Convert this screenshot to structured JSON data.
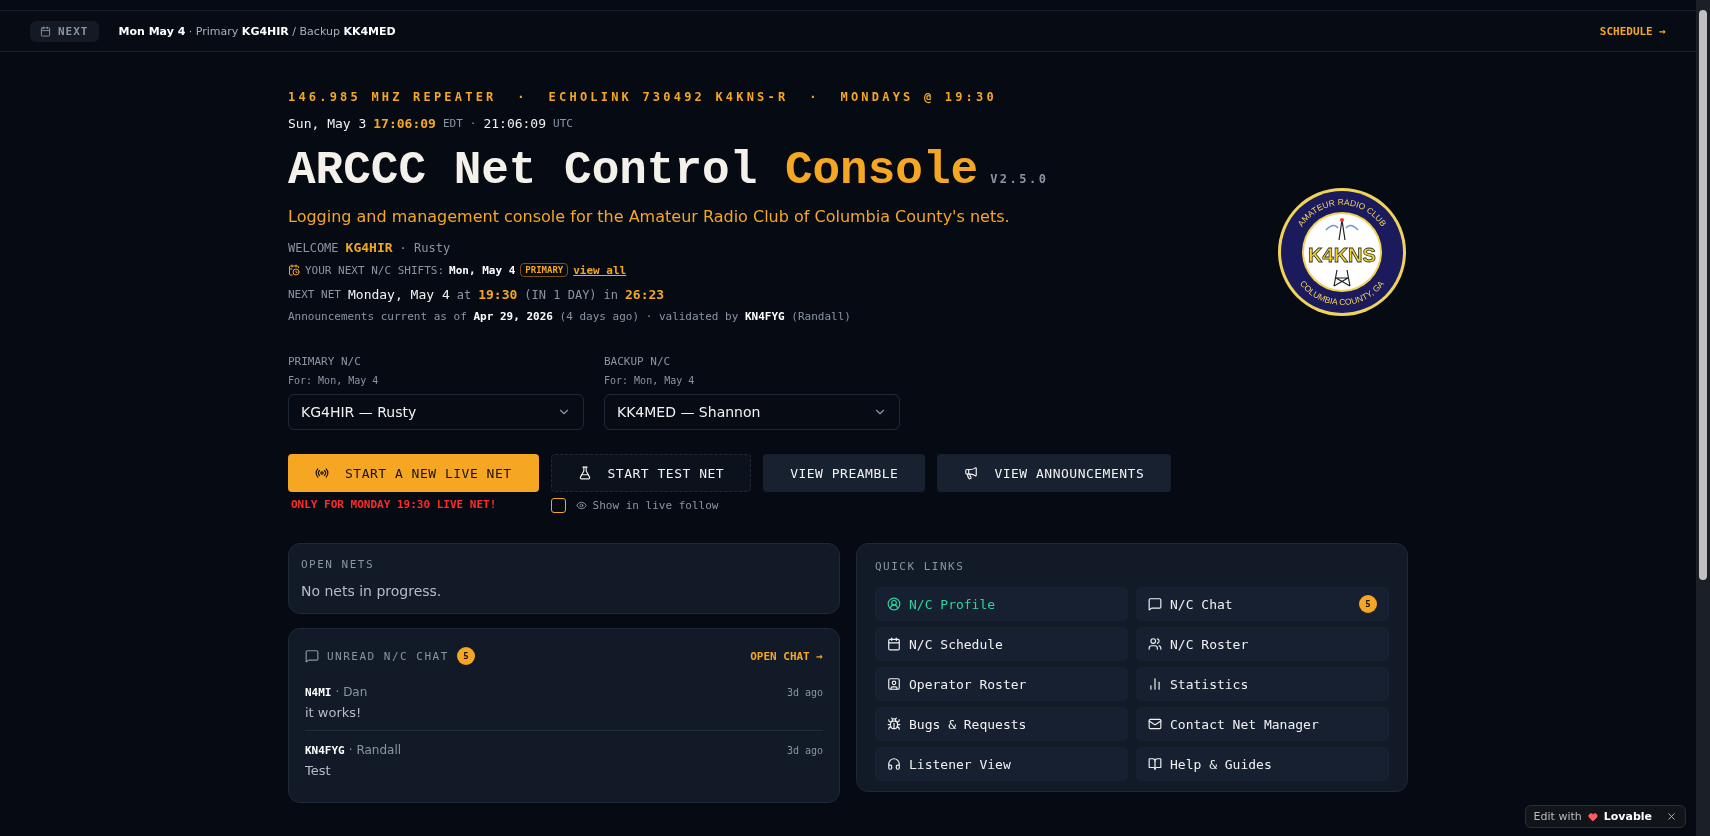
{
  "top_bar": {
    "label": "NEXT",
    "summary": "**Mon May 4** · Primary **KG4HIR** / Backup **KK4MED**",
    "schedule_link": "SCHEDULE →"
  },
  "header": {
    "tagline": "146.985 MHZ REPEATER  ·  ECHOLINK 730492 K4KNS-R  ·  MONDAYS @ 19:30",
    "clock": {
      "date": "Sun, May 3",
      "local_time": "17:06:09",
      "local_zone": "EDT",
      "separator": "·",
      "utc_time": "21:06:09",
      "utc_zone": "UTC"
    },
    "title": "ARCCC Net Control",
    "title_accent": "Console",
    "version": "V2.5.0",
    "subtitle": "Logging and management console for the Amateur Radio Club of Columbia County's nets.",
    "welcome": {
      "label": "WELCOME",
      "callsign": "KG4HIR",
      "name": "· Rusty"
    },
    "shifts": {
      "label": "YOUR NEXT N/C SHIFTS:",
      "date": "Mon, May 4",
      "badge": "PRIMARY",
      "link": "view all"
    },
    "next_net": {
      "label": "NEXT NET",
      "date": "Monday, May 4",
      "at": "at",
      "time": "19:30",
      "relative": "(IN 1 DAY)",
      "in": "in",
      "countdown": "26:23"
    },
    "announcements_note": "Announcements current as of **Apr 29, 2026** (4 days ago) · validated by **KN4FYG** (Randall)"
  },
  "logo": {
    "top_text": "AMATEUR RADIO CLUB",
    "callsign": "K4KNS",
    "bottom_text": "COLUMBIA COUNTY, GA"
  },
  "net_control": [
    {
      "label": "PRIMARY N/C",
      "for": "For: Mon, May 4",
      "value": "KG4HIR — Rusty"
    },
    {
      "label": "BACKUP N/C",
      "for": "For: Mon, May 4",
      "value": "KK4MED — Shannon"
    }
  ],
  "actions": [
    {
      "label": "START A NEW LIVE NET",
      "kind": "primary"
    },
    {
      "label": "START TEST NET",
      "kind": "dashed"
    },
    {
      "label": "VIEW PREAMBLE",
      "kind": "plain"
    },
    {
      "label": "VIEW ANNOUNCEMENTS",
      "kind": "plain"
    }
  ],
  "live_warning": "ONLY FOR MONDAY 19:30 LIVE NET!",
  "live_follow": {
    "label": "Show in live follow",
    "checked": false
  },
  "open_nets": {
    "title": "OPEN NETS",
    "empty_text": "No nets in progress."
  },
  "chat": {
    "title": "UNREAD N/C CHAT",
    "count": "5",
    "link": "OPEN CHAT →",
    "messages": [
      {
        "callsign": "N4MI",
        "name": "· Dan",
        "time": "3d ago",
        "text": "it works!"
      },
      {
        "callsign": "KN4FYG",
        "name": "· Randall",
        "time": "3d ago",
        "text": "Test"
      }
    ]
  },
  "quick_links": {
    "title": "QUICK LINKS",
    "items": [
      {
        "label": "N/C Profile",
        "selected": true
      },
      {
        "label": "N/C Chat",
        "selected": false,
        "badge": "5"
      },
      {
        "label": "N/C Schedule",
        "selected": false
      },
      {
        "label": "N/C Roster",
        "selected": false
      },
      {
        "label": "Operator Roster",
        "selected": false
      },
      {
        "label": "Statistics",
        "selected": false
      },
      {
        "label": "Bugs & Requests",
        "selected": false
      },
      {
        "label": "Contact Net Manager",
        "selected": false
      },
      {
        "label": "Listener View",
        "selected": false
      },
      {
        "label": "Help & Guides",
        "selected": false
      }
    ]
  },
  "lovable_badge": {
    "label": "Edit with",
    "brand": "Lovable"
  }
}
